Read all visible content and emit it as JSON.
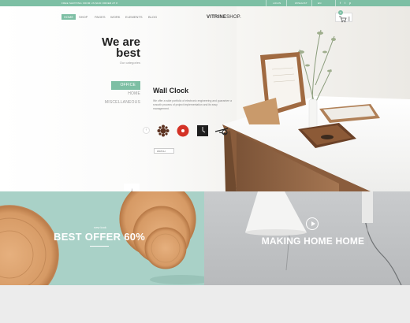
{
  "topbar": {
    "promo": "FREE SHIPPING FROM US $100 ORDER AT 8",
    "login": "LOGIN",
    "wishlist": "WISHLIST",
    "lang": "EN",
    "social": [
      "f",
      "t",
      "p"
    ]
  },
  "nav": {
    "items": [
      "HOME",
      "SHOP",
      "PAGES",
      "WORK",
      "ELEMENTS",
      "BLOG"
    ]
  },
  "logo": {
    "bold": "VITRINE",
    "light": "SHOP."
  },
  "cart": {
    "count": "0"
  },
  "hero": {
    "headline_1": "We are",
    "headline_2": "best",
    "subline": "Our categories",
    "categories": [
      "OFFICE",
      "HOME",
      "MISCELLANEOUS"
    ],
    "product_title": "Wall Clock",
    "product_desc": "We offer a wide portfolio of electronic engineering and guarantee a smooth process of project implementation and its easy management.",
    "select_label": "WATCH",
    "scroll_icon": "down-arrow-icon",
    "prev_icon": "chevron-left-icon"
  },
  "banner_left": {
    "small": "new look",
    "big": "BEST OFFER 60%"
  },
  "banner_right": {
    "big": "MAKING HOME HOME",
    "icon": "play-icon"
  },
  "colors": {
    "accent": "#7dbfa4",
    "mint": "#a9d1c7"
  }
}
